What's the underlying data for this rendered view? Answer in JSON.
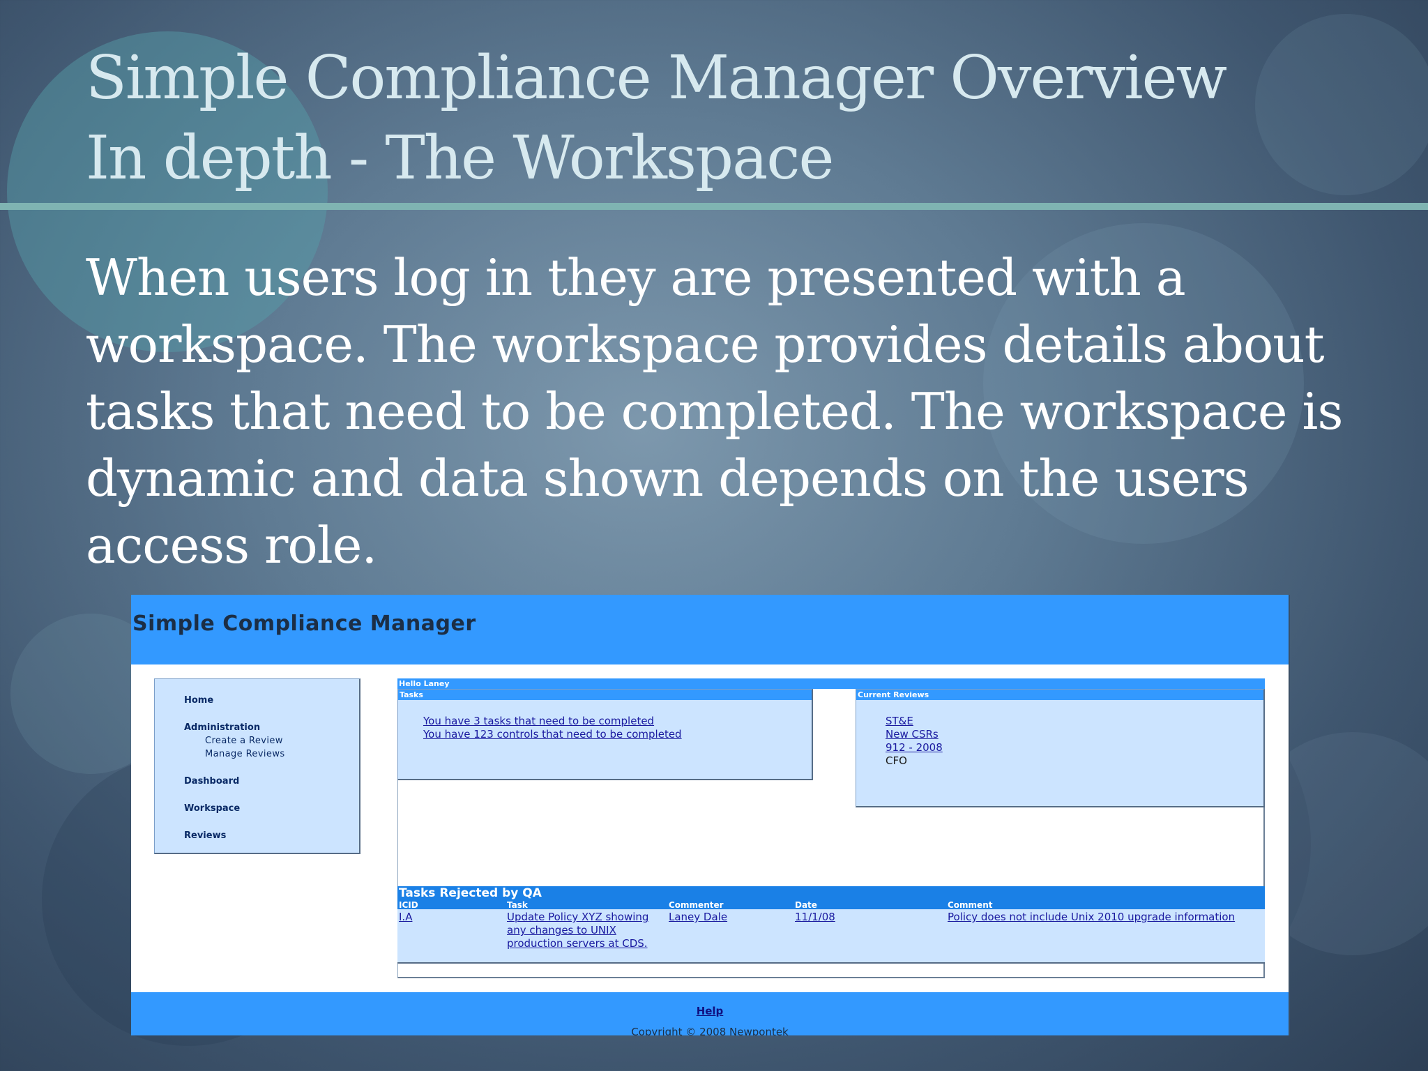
{
  "slide": {
    "title_line1": "Simple Compliance Manager Overview",
    "title_line2": "In depth - The Workspace",
    "body_line1": "When users log in they are presented with a",
    "body_line2": "workspace. The workspace provides details about",
    "body_line3": "tasks that need to be completed. The workspace is",
    "body_line4": "dynamic and data shown depends on the users",
    "body_line5": "access role."
  },
  "app": {
    "title": "Simple Compliance Manager",
    "nav": {
      "home": "Home",
      "administration": "Administration",
      "create_review": "Create a Review",
      "manage_reviews": "Manage Reviews",
      "dashboard": "Dashboard",
      "workspace": "Workspace",
      "reviews": "Reviews"
    },
    "greeting": "Hello Laney",
    "tasks": {
      "header": "Tasks",
      "line1": "You have 3 tasks that need to be completed",
      "line2": "You have 123 controls that need to be completed"
    },
    "current_reviews": {
      "header": "Current Reviews",
      "items": [
        "ST&E",
        "New CSRs",
        "912 - 2008",
        "CFO"
      ]
    },
    "rejected": {
      "title": "Tasks Rejected by QA",
      "columns": [
        "ICID",
        "Task",
        "Commenter",
        "Date",
        "Comment"
      ],
      "row": {
        "icid": "I.A",
        "task_line1": "Update Policy XYZ showing",
        "task_line2": "any changes to UNIX",
        "task_line3": "production servers at CDS.",
        "commenter": "Laney Dale",
        "date": "11/1/08",
        "comment": "Policy does not include Unix 2010 upgrade information"
      }
    },
    "footer": {
      "help": "Help",
      "copyright": "Copyright © 2008 Newpontek"
    }
  }
}
